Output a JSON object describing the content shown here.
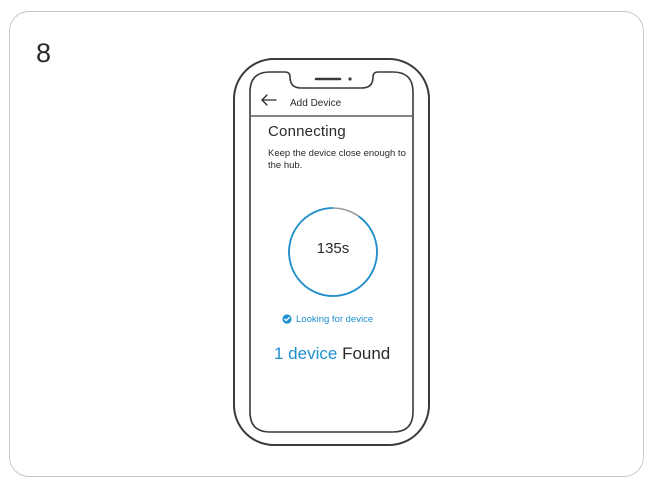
{
  "step": {
    "number": "8"
  },
  "screen": {
    "header_title": "Add Device",
    "heading": "Connecting",
    "instruction": "Keep the device close enough to the hub.",
    "timer": {
      "value": "135s",
      "progress_fraction": 0.9
    },
    "status_text": "Looking for device",
    "found": {
      "count_text": "1 device",
      "suffix": "Found"
    }
  },
  "icons": {
    "back": "back-arrow-icon",
    "status": "check-circle-icon"
  },
  "colors": {
    "accent": "#1e8fcf",
    "text": "#2a2a2a",
    "outline": "#3a3a3a",
    "card_border": "#c8c8c8",
    "ring_track": "#9a9a9a"
  }
}
